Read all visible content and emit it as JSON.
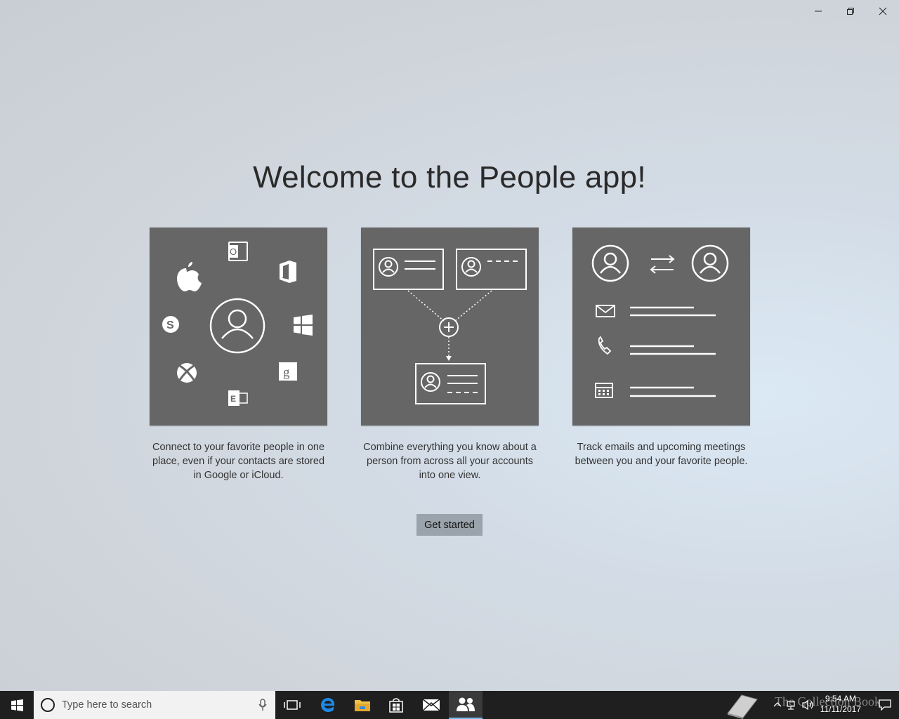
{
  "window": {
    "controls": [
      "minimize",
      "restore",
      "close"
    ]
  },
  "welcome": {
    "title": "Welcome to the People app!",
    "tiles": [
      {
        "caption": "Connect to your favorite people in one place, even if your contacts are stored in Google or iCloud."
      },
      {
        "caption": "Combine everything you know about a person from across all your accounts into one view."
      },
      {
        "caption": "Track emails and upcoming meetings between you and your favorite people."
      }
    ],
    "button_label": "Get started"
  },
  "taskbar": {
    "search_placeholder": "Type here to search",
    "pinned": [
      "task-view-icon",
      "edge-icon",
      "file-explorer-icon",
      "store-icon",
      "mail-icon",
      "people-icon"
    ],
    "active_app": "people-icon",
    "clock_time": "9:54 AM",
    "clock_date": "11/11/2017",
    "watermark": "The Collection Book"
  },
  "colors": {
    "tile_bg": "#666666",
    "button_bg": "#9aa3ab",
    "taskbar_bg": "#1f1f1f",
    "accent": "#76b9ed"
  }
}
